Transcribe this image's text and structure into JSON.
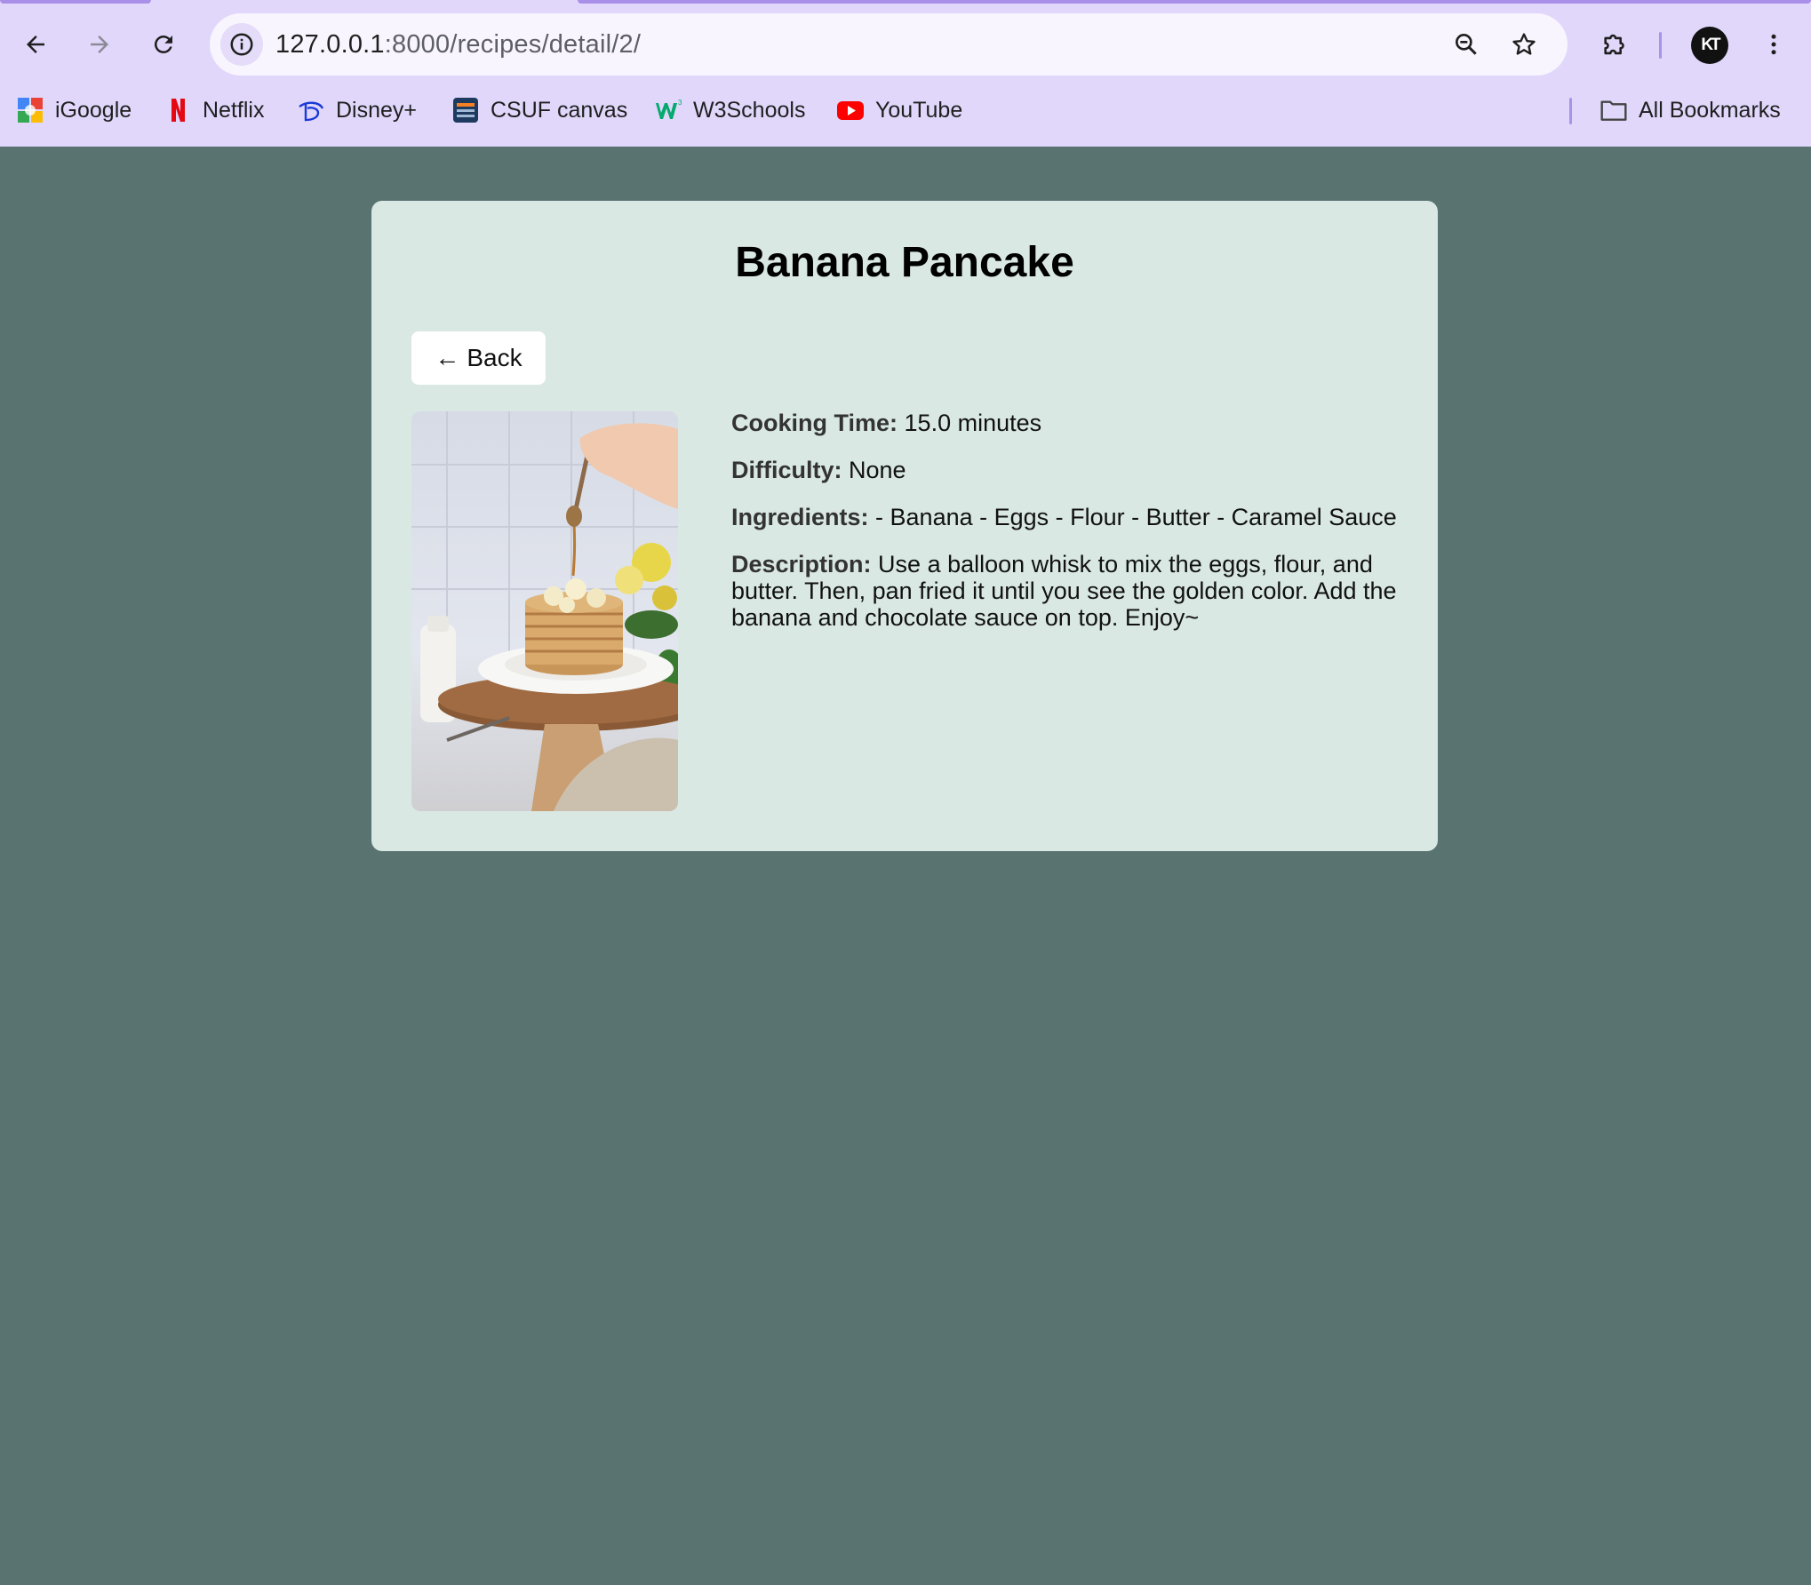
{
  "browser": {
    "url_host": "127.0.0.1",
    "url_path": ":8000/recipes/detail/2/",
    "profile_initials": "KT",
    "icons": {
      "back": "arrow-left-icon",
      "forward": "arrow-right-icon",
      "reload": "reload-icon",
      "site_info": "info-icon",
      "zoom": "zoom-out-icon",
      "bookmark": "star-icon",
      "extensions": "puzzle-icon",
      "menu": "kebab-menu-icon"
    },
    "bookmarks": [
      {
        "label": "iGoogle",
        "icon": "igoogle-icon"
      },
      {
        "label": "Netflix",
        "icon": "netflix-icon"
      },
      {
        "label": "Disney+",
        "icon": "disney-icon"
      },
      {
        "label": "CSUF canvas",
        "icon": "csuf-icon"
      },
      {
        "label": "W3Schools",
        "icon": "w3schools-icon"
      },
      {
        "label": "YouTube",
        "icon": "youtube-icon"
      }
    ],
    "all_bookmarks_label": "All Bookmarks"
  },
  "recipe": {
    "title": "Banana Pancake",
    "back_label": "Back",
    "back_arrow": "←",
    "cooking_time_label": "Cooking Time:",
    "cooking_time_value": "15.0 minutes",
    "difficulty_label": "Difficulty:",
    "difficulty_value": "None",
    "ingredients_label": "Ingredients:",
    "ingredients_value": "- Banana - Eggs - Flour - Butter - Caramel Sauce",
    "description_label": "Description:",
    "description_value": "Use a balloon whisk to mix the eggs, flour, and butter. Then, pan fried it until you see the golden color. Add the banana and chocolate sauce on top. Enjoy~"
  },
  "colors": {
    "page_background": "#587370",
    "card_background": "#d9e8e2",
    "chrome_background": "#e1d7fb"
  }
}
